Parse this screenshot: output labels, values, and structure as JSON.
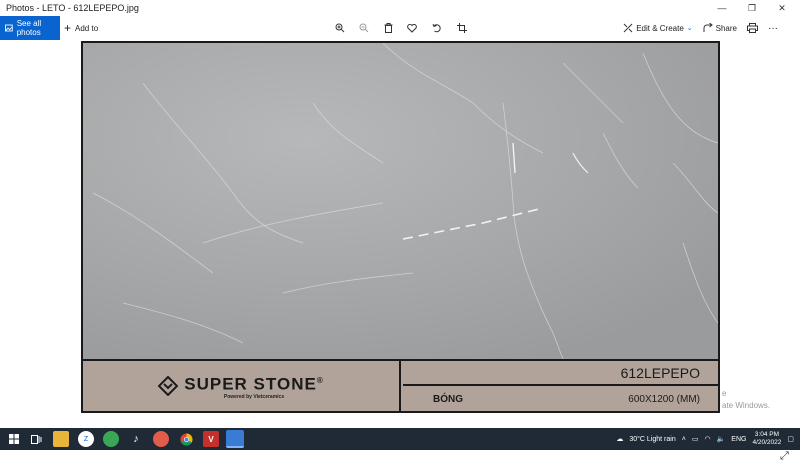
{
  "window": {
    "title": "Photos - LETO - 612LEPEPO.jpg",
    "minimize": "—",
    "maximize": "❐",
    "close": "✕"
  },
  "toolbar": {
    "see_all_label": "See all photos",
    "add_to_label": "Add to",
    "edit_create_label": "Edit & Create",
    "share_label": "Share",
    "icons": [
      "zoom-in-icon",
      "zoom-out-icon",
      "delete-icon",
      "heart-icon",
      "rotate-icon",
      "crop-icon",
      "print-icon",
      "more-icon"
    ]
  },
  "photo": {
    "brand_name": "SUPER STONE",
    "brand_reg": "®",
    "brand_sub": "Powered by Vietceramics",
    "product_code": "612LEPEPO",
    "finish": "BÓNG",
    "size": "600X1200 (MM)"
  },
  "watermark": {
    "line1": "e",
    "line2": "ate Windows."
  },
  "taskbar": {
    "weather": "30°C  Light rain",
    "lang": "ENG",
    "time": "3:04 PM",
    "date": "4/20/2022"
  },
  "colors": {
    "accent": "#0a64d0",
    "taskbar": "#1f2a36",
    "tile_band": "#b1a39a",
    "marble": "#a3a4a5"
  }
}
